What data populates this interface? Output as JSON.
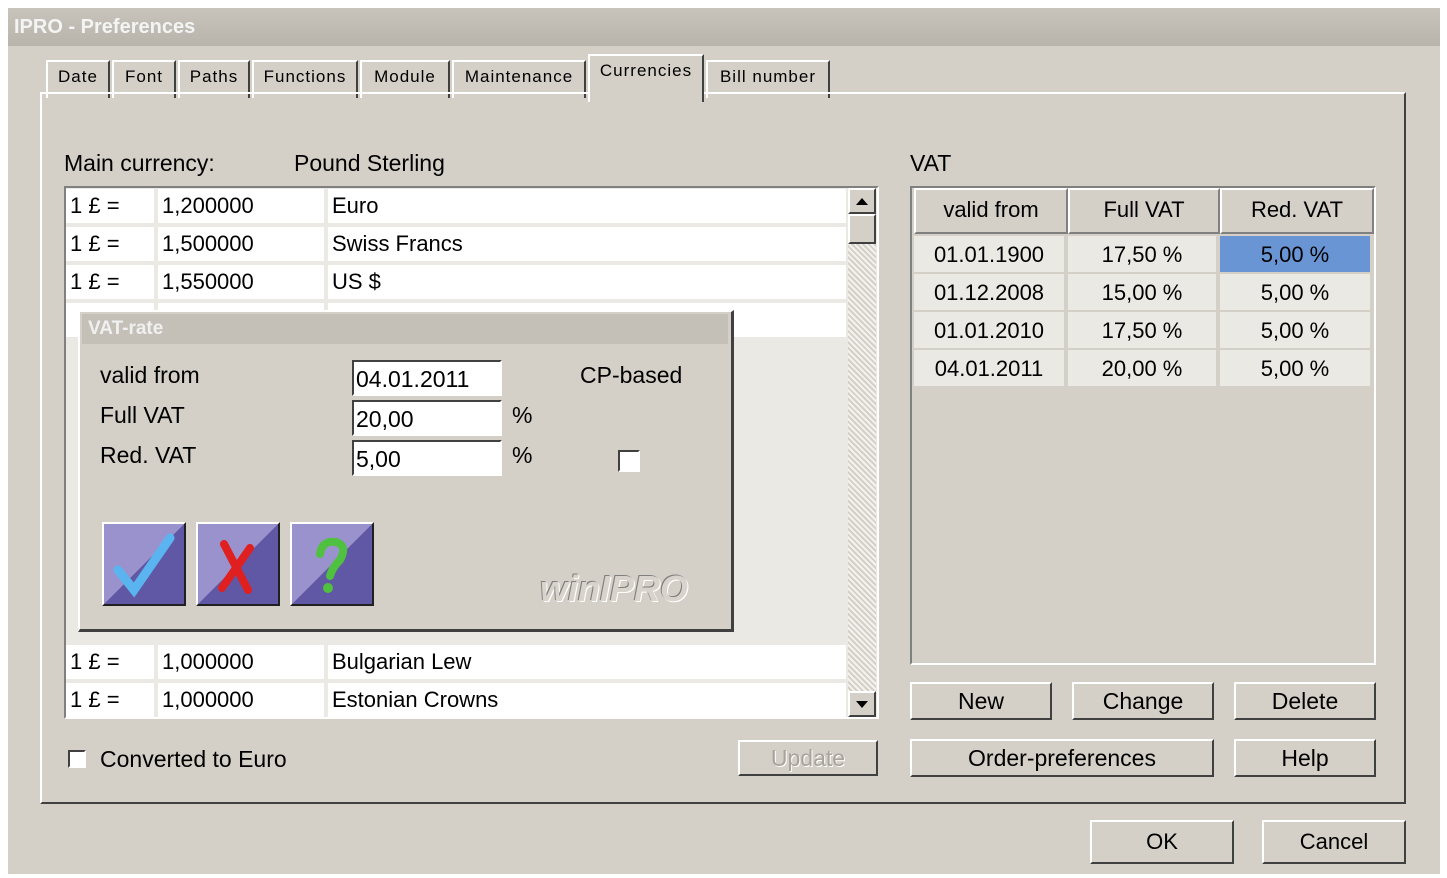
{
  "window": {
    "title": "IPRO - Preferences"
  },
  "tabs": [
    {
      "label": "Date"
    },
    {
      "label": "Font"
    },
    {
      "label": "Paths"
    },
    {
      "label": "Functions"
    },
    {
      "label": "Module"
    },
    {
      "label": "Maintenance"
    },
    {
      "label": "Currencies",
      "active": true
    },
    {
      "label": "Bill number"
    }
  ],
  "currencies": {
    "main_label": "Main currency:",
    "main_value": "Pound Sterling",
    "rows_top": [
      {
        "prefix": "1 £ =",
        "rate": "1,200000",
        "name": "Euro"
      },
      {
        "prefix": "1 £ =",
        "rate": "1,500000",
        "name": "Swiss Francs"
      },
      {
        "prefix": "1 £ =",
        "rate": "1,550000",
        "name": "US $"
      }
    ],
    "rows_bottom": [
      {
        "prefix": "1 £ =",
        "rate": "1,000000",
        "name": "Bulgarian Lew"
      },
      {
        "prefix": "1 £ =",
        "rate": "1,000000",
        "name": "Estonian Crowns"
      }
    ],
    "converted_label": "Converted to Euro",
    "update_label": "Update"
  },
  "vat": {
    "label": "VAT",
    "headers": [
      "valid from",
      "Full VAT",
      "Red. VAT"
    ],
    "rows": [
      [
        "01.01.1900",
        "17,50 %",
        "5,00 %"
      ],
      [
        "01.12.2008",
        "15,00 %",
        "5,00 %"
      ],
      [
        "01.01.2010",
        "17,50 %",
        "5,00 %"
      ],
      [
        "04.01.2011",
        "20,00 %",
        "5,00 %"
      ]
    ],
    "selected_color": "#6a95d4",
    "buttons": {
      "new": "New",
      "change": "Change",
      "delete": "Delete",
      "order": "Order-preferences",
      "help": "Help"
    }
  },
  "footer": {
    "ok": "OK",
    "cancel": "Cancel"
  },
  "dialog": {
    "title": "VAT-rate",
    "valid_from_label": "valid from",
    "valid_from_value": "04.01.2011",
    "full_vat_label": "Full VAT",
    "full_vat_value": "20,00",
    "red_vat_label": "Red. VAT",
    "red_vat_value": "5,00",
    "percent": "%",
    "cp_based_label": "CP-based",
    "icons": [
      "check-icon",
      "cross-icon",
      "question-icon"
    ],
    "logo": "winIPRO"
  }
}
